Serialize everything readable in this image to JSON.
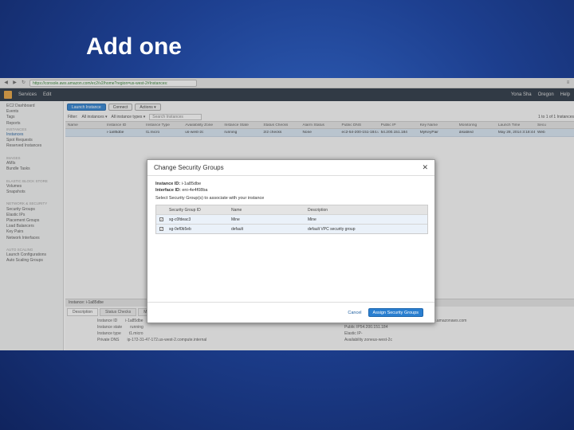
{
  "slide": {
    "title": "Add one"
  },
  "browser": {
    "url": "https://console.aws.amazon.com/ec2/v2/home?region=us-west-2#Instances:"
  },
  "aws_nav": {
    "services": "Services",
    "edit": "Edit",
    "user": "Yona Sha",
    "region": "Oregon",
    "help": "Help"
  },
  "sidebar": {
    "items": [
      {
        "text": "EC2 Dashboard",
        "type": "item"
      },
      {
        "text": "Events",
        "type": "item"
      },
      {
        "text": "Tags",
        "type": "item"
      },
      {
        "text": "Reports",
        "type": "item"
      },
      {
        "text": "INSTANCES",
        "type": "head"
      },
      {
        "text": "Instances",
        "type": "active"
      },
      {
        "text": "Spot Requests",
        "type": "item"
      },
      {
        "text": "Reserved Instances",
        "type": "item"
      },
      {
        "text": "",
        "type": "item"
      },
      {
        "text": "IMAGES",
        "type": "head"
      },
      {
        "text": "AMIs",
        "type": "item"
      },
      {
        "text": "Bundle Tasks",
        "type": "item"
      },
      {
        "text": "",
        "type": "item"
      },
      {
        "text": "ELASTIC BLOCK STORE",
        "type": "head"
      },
      {
        "text": "Volumes",
        "type": "item"
      },
      {
        "text": "Snapshots",
        "type": "item"
      },
      {
        "text": "",
        "type": "item"
      },
      {
        "text": "NETWORK & SECURITY",
        "type": "head"
      },
      {
        "text": "Security Groups",
        "type": "item"
      },
      {
        "text": "Elastic IPs",
        "type": "item"
      },
      {
        "text": "Placement Groups",
        "type": "item"
      },
      {
        "text": "Load Balancers",
        "type": "item"
      },
      {
        "text": "Key Pairs",
        "type": "item"
      },
      {
        "text": "Network Interfaces",
        "type": "item"
      },
      {
        "text": "",
        "type": "item"
      },
      {
        "text": "AUTO SCALING",
        "type": "head"
      },
      {
        "text": "Launch Configurations",
        "type": "item"
      },
      {
        "text": "Auto Scaling Groups",
        "type": "item"
      }
    ]
  },
  "toolbar": {
    "launch": "Launch Instance",
    "connect": "Connect",
    "actions": "Actions ▾"
  },
  "filter": {
    "label": "Filter:",
    "state": "All instances ▾",
    "types": "All instance types ▾",
    "search_placeholder": "Search Instances",
    "pager": "1 to 1 of 1 Instances"
  },
  "instances": {
    "columns": [
      "Name",
      "Instance ID",
      "Instance Type",
      "Availability Zone",
      "Instance State",
      "Status Checks",
      "Alarm Status",
      "Public DNS",
      "Public IP",
      "Key Name",
      "Monitoring",
      "Launch Time",
      "Secu"
    ],
    "row": [
      "",
      "i-1a85dbe",
      "t1.micro",
      "us-west-2c",
      "running",
      "2/2 checks",
      "None",
      "ec2-54-200-151-184.us...",
      "54.200.151.184",
      "MyKeyPair",
      "disabled",
      "May 28, 2014 3:18:44 PM UTC",
      "Web"
    ]
  },
  "detail": {
    "bar": "Instance: i-1a85dbe",
    "tabs": [
      "Description",
      "Status Checks",
      "Monitoring",
      "Tags"
    ],
    "left": [
      {
        "k": "Instance ID",
        "v": "i-1a85dbe"
      },
      {
        "k": "Instance state",
        "v": "running"
      },
      {
        "k": "Instance type",
        "v": "t1.micro"
      },
      {
        "k": "Private DNS",
        "v": "ip-172-31-47-172.us-west-2.compute.internal"
      }
    ],
    "right": [
      {
        "k": "Public DNS",
        "v": "ec2-54-200-151-184.us-west-2.compute.amazonaws.com"
      },
      {
        "k": "Public IP",
        "v": "54.200.151.184"
      },
      {
        "k": "Elastic IP",
        "v": "-"
      },
      {
        "k": "Availability zone",
        "v": "us-west-2c"
      }
    ]
  },
  "modal": {
    "title": "Change Security Groups",
    "instance_id_label": "Instance ID:",
    "instance_id": "i-1a85dbe",
    "interface_label": "Interface ID:",
    "interface_id": "eni-4e4f08ba",
    "prompt": "Select Security Group(s) to associate with your instance",
    "columns": [
      "Security Group ID",
      "Name",
      "Description"
    ],
    "rows": [
      {
        "id": "sg-c0fdeac3",
        "name": "Mine",
        "desc": "Mine",
        "checked": true
      },
      {
        "id": "sg-0ef0b5eb",
        "name": "default",
        "desc": "default VPC security group",
        "checked": true
      }
    ],
    "cancel": "Cancel",
    "assign": "Assign Security Groups"
  }
}
